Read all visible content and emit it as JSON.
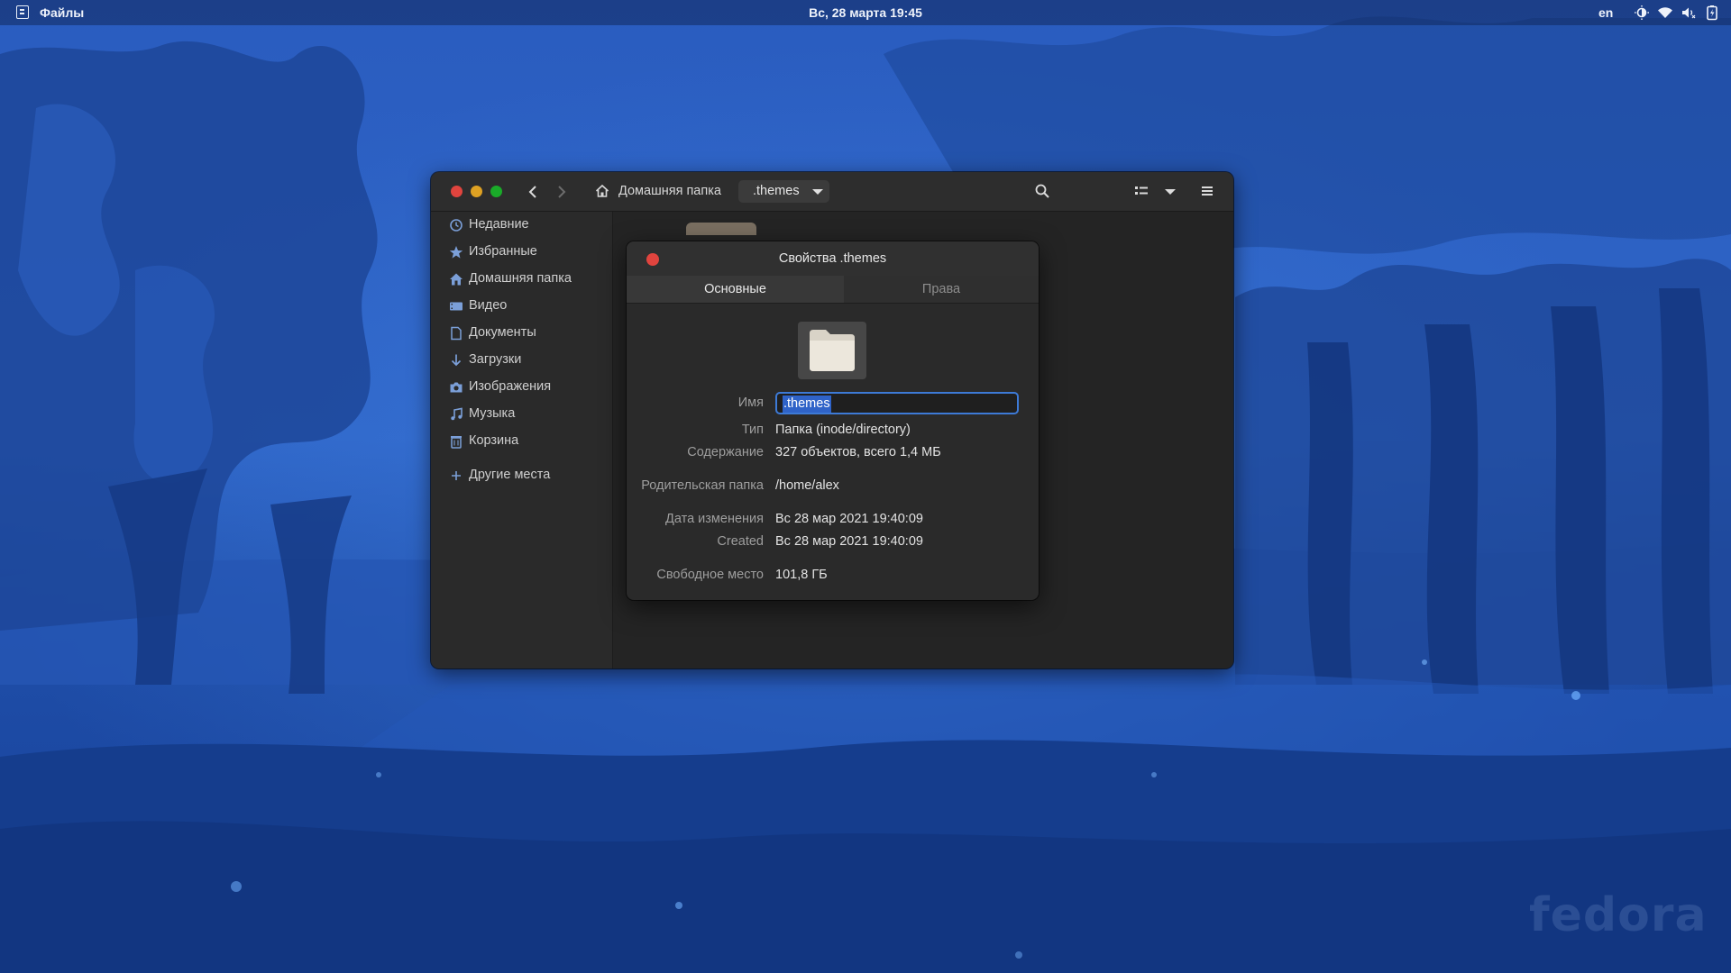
{
  "topbar": {
    "app_name": "Файлы",
    "clock": "Вс, 28 марта  19:45",
    "lang": "en",
    "tray_icons": [
      "night-light-icon",
      "wifi-icon",
      "volume-icon",
      "battery-icon"
    ]
  },
  "wallpaper": {
    "watermark": "fedora",
    "colors": {
      "sky": "#2d62c4",
      "deep": "#123a8a",
      "trees": "#1c3f8f"
    }
  },
  "files_window": {
    "path_home": "Домашняя папка",
    "path_current": ".themes",
    "sidebar": [
      {
        "icon": "clock-icon",
        "label": "Недавние"
      },
      {
        "icon": "star-icon",
        "label": "Избранные"
      },
      {
        "icon": "home-icon",
        "label": "Домашняя папка"
      },
      {
        "icon": "video-icon",
        "label": "Видео"
      },
      {
        "icon": "document-icon",
        "label": "Документы"
      },
      {
        "icon": "download-icon",
        "label": "Загрузки"
      },
      {
        "icon": "camera-icon",
        "label": "Изображения"
      },
      {
        "icon": "music-icon",
        "label": "Музыка"
      },
      {
        "icon": "trash-icon",
        "label": "Корзина"
      },
      {
        "icon": "plus-icon",
        "label": "Другие места"
      }
    ],
    "accent": "#3d7ad6"
  },
  "properties_dialog": {
    "title": "Свойства .themes",
    "tabs": [
      "Основные",
      "Права"
    ],
    "active_tab": "Основные",
    "name_label": "Имя",
    "name_value": ".themes",
    "rows": [
      {
        "label": "Тип",
        "value": "Папка (inode/directory)"
      },
      {
        "label": "Содержание",
        "value": "327 объектов, всего 1,4 МБ"
      },
      {
        "label": "Родительская папка",
        "value": "/home/alex"
      },
      {
        "label": "Дата изменения",
        "value": "Вс 28 мар 2021 19:40:09"
      },
      {
        "label": "Created",
        "value": "Вс 28 мар 2021 19:40:09"
      },
      {
        "label": "Свободное место",
        "value": "101,8 ГБ"
      }
    ]
  }
}
